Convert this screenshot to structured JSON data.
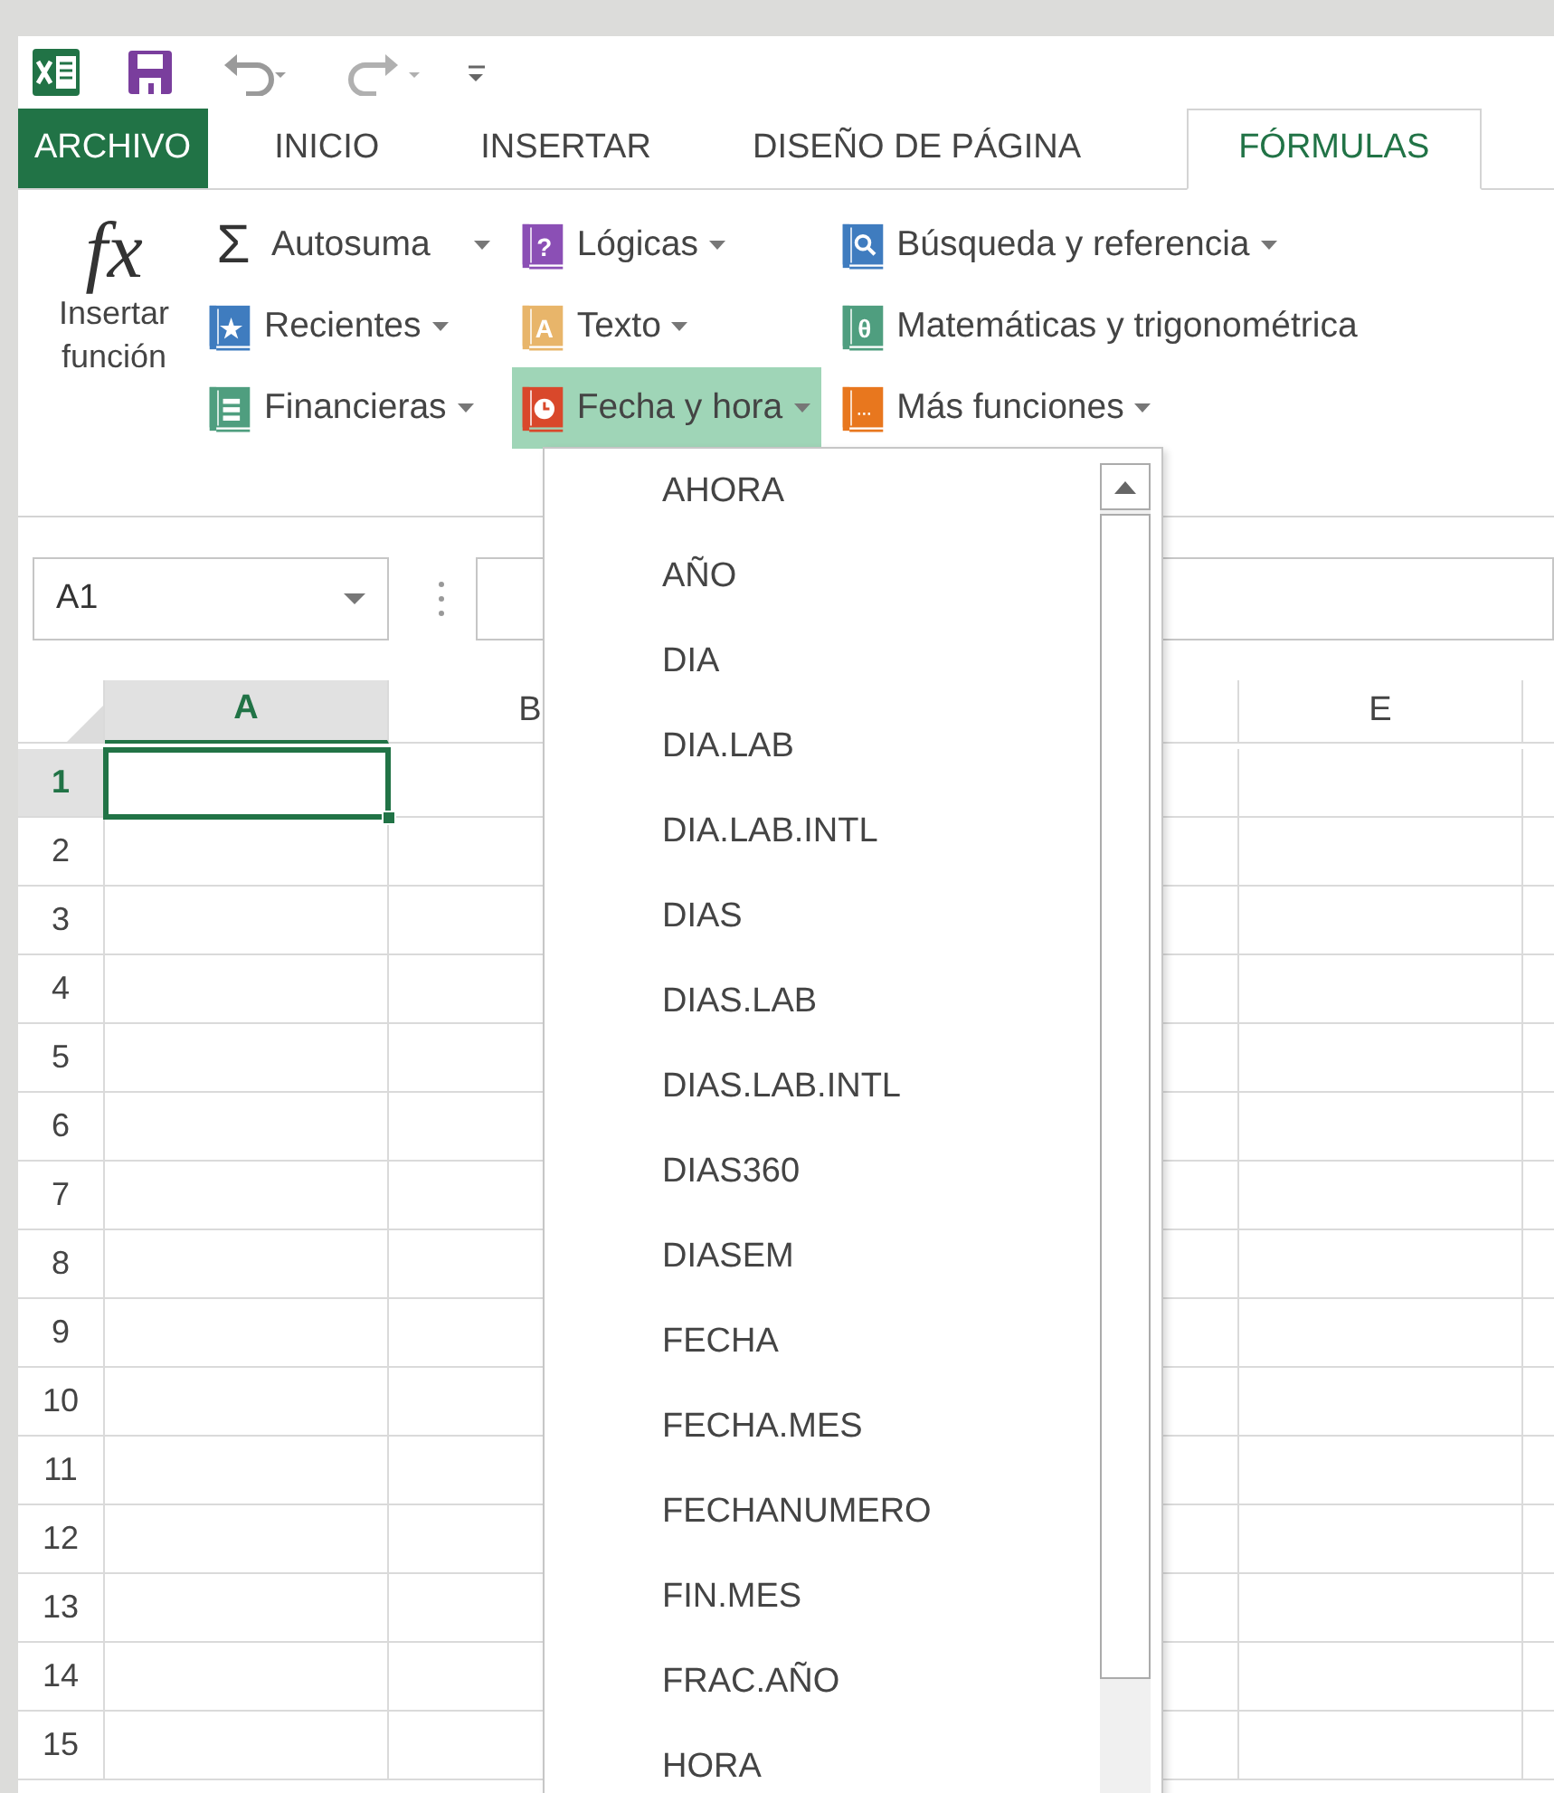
{
  "tabs": [
    {
      "label": "ARCHIVO",
      "kind": "file",
      "selected": false
    },
    {
      "label": "INICIO",
      "kind": "tab",
      "selected": false
    },
    {
      "label": "INSERTAR",
      "kind": "tab",
      "selected": false
    },
    {
      "label": "DISEÑO DE PÁGINA",
      "kind": "tab",
      "selected": false
    },
    {
      "label": "FÓRMULAS",
      "kind": "tab",
      "selected": true
    }
  ],
  "ribbon": {
    "insert_function": {
      "glyph": "fx",
      "label": "Insertar función"
    },
    "columns": [
      [
        {
          "label": "Autosuma",
          "kind": "split",
          "glyph": "Σ",
          "selected": false
        },
        {
          "label": "Recientes",
          "kind": "menu",
          "glyph": "★",
          "color": "#3f7cbf",
          "selected": false
        },
        {
          "label": "Financieras",
          "kind": "menu",
          "color": "#4f9e7f",
          "selected": false
        }
      ],
      [
        {
          "label": "Lógicas",
          "kind": "menu",
          "glyph": "?",
          "color": "#8b4fb5",
          "selected": false
        },
        {
          "label": "Texto",
          "kind": "menu",
          "glyph": "A",
          "color": "#e8b56a",
          "selected": false
        },
        {
          "label": "Fecha y hora",
          "kind": "menu",
          "color": "#d9482b",
          "selected": true
        }
      ],
      [
        {
          "label": "Búsqueda y referencia",
          "kind": "menu",
          "color": "#3f7cbf",
          "selected": false
        },
        {
          "label": "Matemáticas y trigonométrica",
          "kind": "menu",
          "glyph": "θ",
          "color": "#4f9e7f",
          "selected": false
        },
        {
          "label": "Más funciones",
          "kind": "menu",
          "glyph": "···",
          "color": "#e8771e",
          "selected": false
        }
      ]
    ]
  },
  "name_box": {
    "value": "A1"
  },
  "sheet": {
    "columns": [
      {
        "label": "A",
        "selected": true
      },
      {
        "label": "B",
        "selected": false
      },
      {
        "label": "E",
        "selected": false
      }
    ],
    "rows": [
      {
        "label": "1",
        "selected": true
      },
      {
        "label": "2",
        "selected": false
      },
      {
        "label": "3",
        "selected": false
      },
      {
        "label": "4",
        "selected": false
      },
      {
        "label": "5",
        "selected": false
      },
      {
        "label": "6",
        "selected": false
      },
      {
        "label": "7",
        "selected": false
      },
      {
        "label": "8",
        "selected": false
      },
      {
        "label": "9",
        "selected": false
      },
      {
        "label": "10",
        "selected": false
      },
      {
        "label": "11",
        "selected": false
      },
      {
        "label": "12",
        "selected": false
      },
      {
        "label": "13",
        "selected": false
      },
      {
        "label": "14",
        "selected": false
      },
      {
        "label": "15",
        "selected": false
      }
    ]
  },
  "function_menu": {
    "items": [
      "AHORA",
      "AÑO",
      "DIA",
      "DIA.LAB",
      "DIA.LAB.INTL",
      "DIAS",
      "DIAS.LAB",
      "DIAS.LAB.INTL",
      "DIAS360",
      "DIASEM",
      "FECHA",
      "FECHA.MES",
      "FECHANUMERO",
      "FIN.MES",
      "FRAC.AÑO",
      "HORA"
    ]
  }
}
